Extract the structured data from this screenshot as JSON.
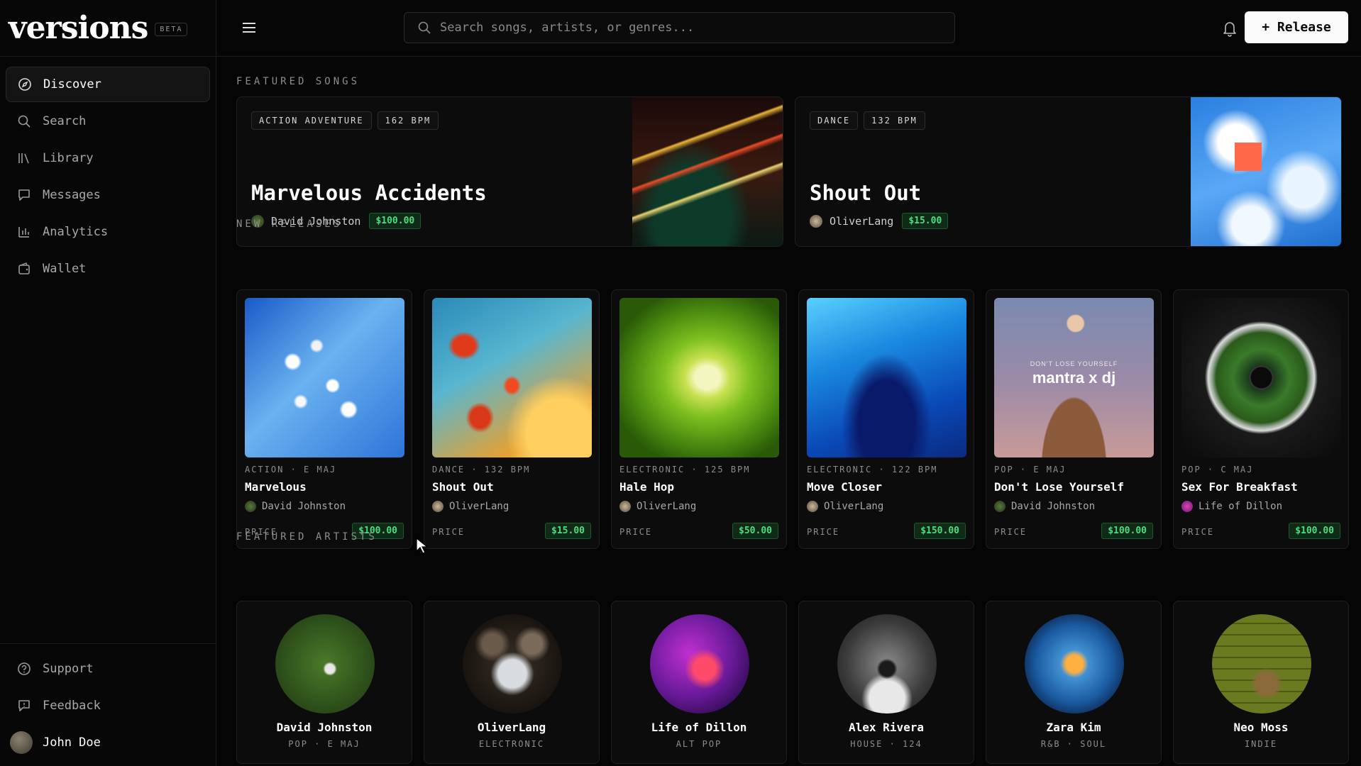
{
  "brand": {
    "logo": "versions",
    "badge": "BETA"
  },
  "sidebar": {
    "items": [
      {
        "label": "Discover",
        "icon": "compass-icon"
      },
      {
        "label": "Search",
        "icon": "search-icon"
      },
      {
        "label": "Library",
        "icon": "library-icon"
      },
      {
        "label": "Messages",
        "icon": "message-icon"
      },
      {
        "label": "Analytics",
        "icon": "bar-chart-icon"
      },
      {
        "label": "Wallet",
        "icon": "wallet-icon"
      }
    ],
    "bottom": [
      {
        "label": "Support",
        "icon": "help-circle-icon"
      },
      {
        "label": "Feedback",
        "icon": "feedback-icon"
      }
    ],
    "user": {
      "name": "John Doe"
    }
  },
  "topbar": {
    "search_placeholder": "Search songs, artists, or genres...",
    "release_label": "+ Release"
  },
  "sections": {
    "featured_songs": "FEATURED SONGS",
    "new_releases": "NEW RELEASES",
    "featured_artists": "FEATURED ARTISTS"
  },
  "featured_songs": [
    {
      "tags": [
        "ACTION ADVENTURE",
        "162 BPM"
      ],
      "title": "Marvelous Accidents",
      "artist": "David Johnston",
      "price": "$100.00"
    },
    {
      "tags": [
        "DANCE",
        "132 BPM"
      ],
      "title": "Shout Out",
      "artist": "OliverLang",
      "price": "$15.00"
    }
  ],
  "new_releases": [
    {
      "meta": "ACTION · E MAJ",
      "title": "Marvelous",
      "artist": "David Johnston",
      "price_label": "PRICE",
      "price": "$100.00"
    },
    {
      "meta": "DANCE · 132 BPM",
      "title": "Shout Out",
      "artist": "OliverLang",
      "price_label": "PRICE",
      "price": "$15.00"
    },
    {
      "meta": "ELECTRONIC · 125 BPM",
      "title": "Hale Hop",
      "artist": "OliverLang",
      "price_label": "PRICE",
      "price": "$50.00"
    },
    {
      "meta": "ELECTRONIC · 122 BPM",
      "title": "Move Closer",
      "artist": "OliverLang",
      "price_label": "PRICE",
      "price": "$150.00"
    },
    {
      "meta": "POP · E MAJ",
      "title": "Don't Lose Yourself",
      "artist": "David Johnston",
      "price_label": "PRICE",
      "price": "$100.00",
      "art_caption": "DON'T LOSE YOURSELF",
      "art_title": "mantra x dj"
    },
    {
      "meta": "POP · C MAJ",
      "title": "Sex For Breakfast",
      "artist": "Life of Dillon",
      "price_label": "PRICE",
      "price": "$100.00"
    }
  ],
  "featured_artists": [
    {
      "name": "David Johnston",
      "genre": "POP · E MAJ"
    },
    {
      "name": "OliverLang",
      "genre": "ELECTRONIC"
    },
    {
      "name": "Life of Dillon",
      "genre": "ALT POP"
    },
    {
      "name": "Alex Rivera",
      "genre": "HOUSE · 124"
    },
    {
      "name": "Zara Kim",
      "genre": "R&B · SOUL"
    },
    {
      "name": "Neo Moss",
      "genre": "INDIE"
    }
  ],
  "colors": {
    "accent_green": "#4ade80",
    "background": "#050505",
    "card": "#0c0c0c"
  }
}
